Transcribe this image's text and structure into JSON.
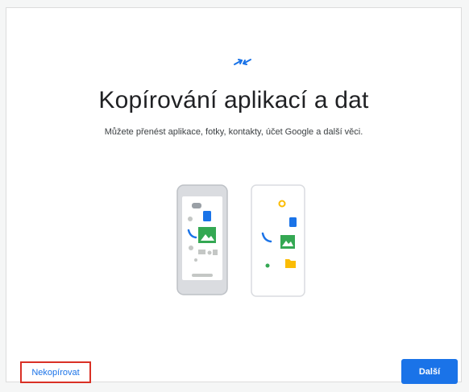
{
  "screen": {
    "title": "Kopírování aplikací a dat",
    "subtitle": "Můžete přenést aplikace, fotky, kontakty, účet Google a další věci."
  },
  "icons": {
    "header": "transfer-arrows-icon",
    "illustration": "two-phones-illustration"
  },
  "actions": {
    "skip_label": "Nekopírovat",
    "next_label": "Další"
  },
  "colors": {
    "accent": "#1a73e8",
    "highlight": "#d93025",
    "google_green": "#34a853",
    "google_yellow": "#fbbc04"
  }
}
